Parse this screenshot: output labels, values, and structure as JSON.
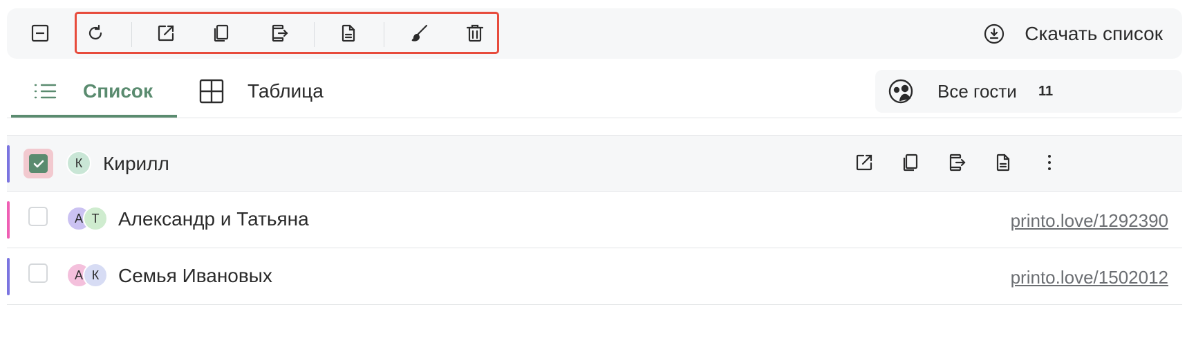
{
  "toolbar": {
    "buttons": [
      "collapse-icon",
      "refresh-icon",
      "open-external-icon",
      "copy-icon",
      "export-device-icon",
      "document-icon",
      "brush-icon",
      "trash-icon"
    ],
    "download_label": "Скачать список"
  },
  "tabs": [
    {
      "label": "Список",
      "icon": "list-icon",
      "active": true
    },
    {
      "label": "Таблица",
      "icon": "grid-icon",
      "active": false
    }
  ],
  "filter": {
    "label": "Все гости",
    "count": "11"
  },
  "guests": [
    {
      "name": "Кирилл",
      "initials": [
        "К"
      ],
      "selected": true,
      "bar_color": "#7b74e0",
      "link": ""
    },
    {
      "name": "Александр и Татьяна",
      "initials": [
        "А",
        "Т"
      ],
      "selected": false,
      "bar_color": "#ef5fb4",
      "link": "printo.love/1292390"
    },
    {
      "name": "Семья Ивановых",
      "initials": [
        "А",
        "К"
      ],
      "selected": false,
      "bar_color": "#7b74e0",
      "link": "printo.love/1502012"
    }
  ],
  "colors": {
    "accent": "#5a8b6f",
    "highlight": "#e74b3c"
  }
}
